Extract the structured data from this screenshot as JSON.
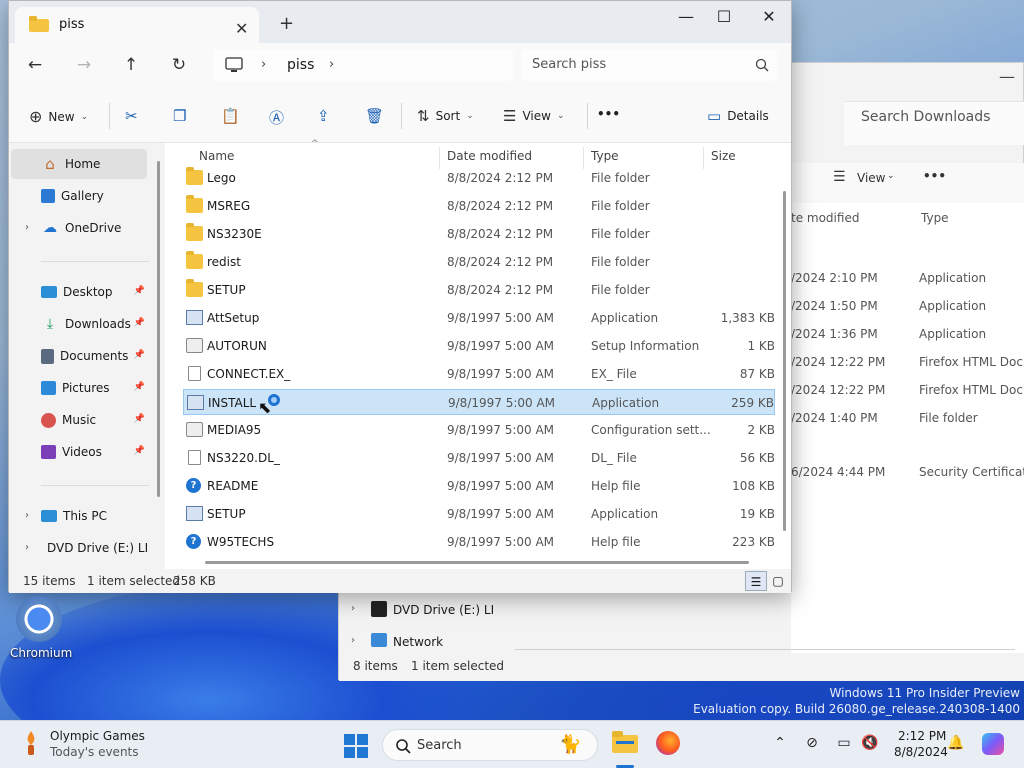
{
  "window": {
    "tab_title": "piss",
    "tab_close": "✕",
    "tab_add": "+",
    "minimize": "—",
    "maximize": "☐",
    "close": "✕"
  },
  "address": {
    "crumb": "piss",
    "search_placeholder": "Search piss"
  },
  "toolbar": {
    "new": "New",
    "sort": "Sort",
    "view": "View",
    "more": "•••",
    "details": "Details"
  },
  "nav": {
    "home": "Home",
    "gallery": "Gallery",
    "onedrive": "OneDrive",
    "desktop": "Desktop",
    "downloads": "Downloads",
    "documents": "Documents",
    "pictures": "Pictures",
    "music": "Music",
    "videos": "Videos",
    "thispc": "This PC",
    "dvd": "DVD Drive (E:) LI"
  },
  "columns": {
    "name": "Name",
    "date": "Date modified",
    "type": "Type",
    "size": "Size"
  },
  "files": [
    {
      "name": "Lego",
      "date": "8/8/2024 2:12 PM",
      "type": "File folder",
      "size": "",
      "icon": "folder"
    },
    {
      "name": "MSREG",
      "date": "8/8/2024 2:12 PM",
      "type": "File folder",
      "size": "",
      "icon": "folder"
    },
    {
      "name": "NS3230E",
      "date": "8/8/2024 2:12 PM",
      "type": "File folder",
      "size": "",
      "icon": "folder"
    },
    {
      "name": "redist",
      "date": "8/8/2024 2:12 PM",
      "type": "File folder",
      "size": "",
      "icon": "folder"
    },
    {
      "name": "SETUP",
      "date": "8/8/2024 2:12 PM",
      "type": "File folder",
      "size": "",
      "icon": "folder"
    },
    {
      "name": "AttSetup",
      "date": "9/8/1997 5:00 AM",
      "type": "Application",
      "size": "1,383 KB",
      "icon": "app"
    },
    {
      "name": "AUTORUN",
      "date": "9/8/1997 5:00 AM",
      "type": "Setup Information",
      "size": "1 KB",
      "icon": "cfg"
    },
    {
      "name": "CONNECT.EX_",
      "date": "9/8/1997 5:00 AM",
      "type": "EX_ File",
      "size": "87 KB",
      "icon": "doc"
    },
    {
      "name": "INSTALL",
      "date": "9/8/1997 5:00 AM",
      "type": "Application",
      "size": "259 KB",
      "icon": "app"
    },
    {
      "name": "MEDIA95",
      "date": "9/8/1997 5:00 AM",
      "type": "Configuration sett...",
      "size": "2 KB",
      "icon": "cfg"
    },
    {
      "name": "NS3220.DL_",
      "date": "9/8/1997 5:00 AM",
      "type": "DL_ File",
      "size": "56 KB",
      "icon": "doc"
    },
    {
      "name": "README",
      "date": "9/8/1997 5:00 AM",
      "type": "Help file",
      "size": "108 KB",
      "icon": "help"
    },
    {
      "name": "SETUP",
      "date": "9/8/1997 5:00 AM",
      "type": "Application",
      "size": "19 KB",
      "icon": "app"
    },
    {
      "name": "W95TECHS",
      "date": "9/8/1997 5:00 AM",
      "type": "Help file",
      "size": "223 KB",
      "icon": "help"
    }
  ],
  "status": {
    "count": "15 items",
    "selected": "1 item selected",
    "size": "258 KB"
  },
  "back_window": {
    "search_placeholder": "Search Downloads",
    "view": "View",
    "more": "•••",
    "col_date": "te modified",
    "col_type": "Type",
    "rows": [
      {
        "date": "/2024 2:10 PM",
        "type": "Application"
      },
      {
        "date": "/2024 1:50 PM",
        "type": "Application"
      },
      {
        "date": "/2024 1:36 PM",
        "type": "Application"
      },
      {
        "date": "/2024 12:22 PM",
        "type": "Firefox HTML Doc..."
      },
      {
        "date": "/2024 12:22 PM",
        "type": "Firefox HTML Doc..."
      },
      {
        "date": "/2024 1:40 PM",
        "type": "File folder"
      },
      {
        "date": "6/2024 4:44 PM",
        "type": "Security Certificate"
      }
    ],
    "nav_dvd": "DVD Drive (E:) LI",
    "nav_network": "Network",
    "status_count": "8 items",
    "status_selected": "1 item selected"
  },
  "desktop": {
    "chromium_label": "Chromium",
    "watermark_line1": "Windows 11 Pro Insider Preview",
    "watermark_line2": "Evaluation copy. Build 26080.ge_release.240308-1400"
  },
  "taskbar": {
    "widget_title": "Olympic Games",
    "widget_sub": "Today's events",
    "search": "Search",
    "time": "2:12 PM",
    "date": "8/8/2024"
  }
}
